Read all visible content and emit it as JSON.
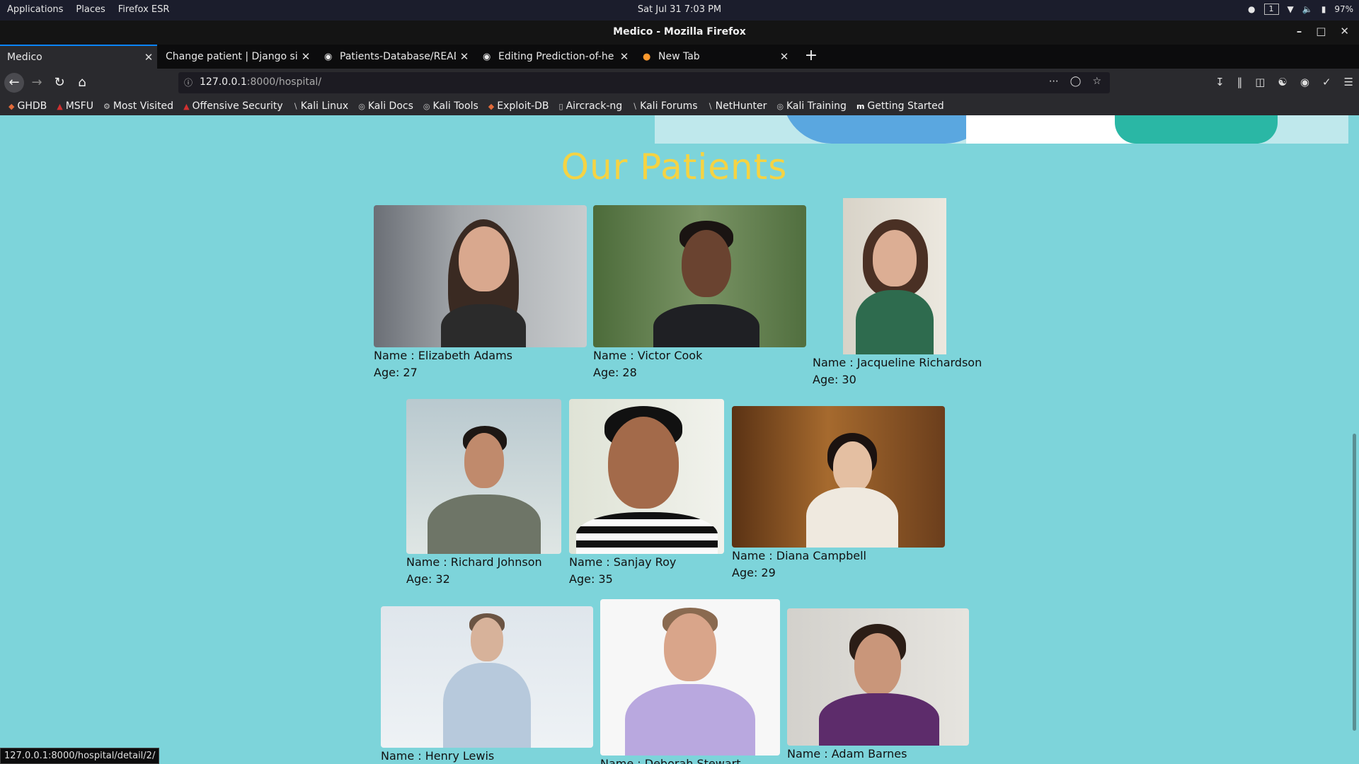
{
  "system": {
    "menus": [
      "Applications",
      "Places",
      "Firefox ESR"
    ],
    "clock": "Sat Jul 31   7:03 PM",
    "workspace": "1",
    "battery": "97%"
  },
  "window": {
    "title": "Medico - Mozilla Firefox"
  },
  "tabs": [
    {
      "title": "Medico",
      "favicon": "none"
    },
    {
      "title": "Change patient | Django site",
      "favicon": "none"
    },
    {
      "title": "Patients-Database/READ",
      "favicon": "github-icon"
    },
    {
      "title": "Editing Prediction-of-he",
      "favicon": "github-icon"
    },
    {
      "title": "New Tab",
      "favicon": "firefox-icon"
    }
  ],
  "address": {
    "host": "127.0.0.1",
    "rest": ":8000/hospital/"
  },
  "bookmarks": [
    "GHDB",
    "MSFU",
    "Most Visited",
    "Offensive Security",
    "Kali Linux",
    "Kali Docs",
    "Kali Tools",
    "Exploit-DB",
    "Aircrack-ng",
    "Kali Forums",
    "NetHunter",
    "Kali Training",
    "Getting Started"
  ],
  "page": {
    "heading": "Our Patients",
    "patients": [
      {
        "name": "Name : Elizabeth Adams",
        "age": "Age: 27"
      },
      {
        "name": "Name : Victor Cook",
        "age": "Age: 28"
      },
      {
        "name": "Name : Jacqueline Richardson",
        "age": "Age: 30"
      },
      {
        "name": "Name : Richard Johnson",
        "age": "Age: 32"
      },
      {
        "name": "Name : Sanjay Roy",
        "age": "Age: 35"
      },
      {
        "name": "Name : Diana Campbell",
        "age": "Age: 29"
      },
      {
        "name": "Name : Henry Lewis",
        "age": ""
      },
      {
        "name": "Name : Deborah Stewart",
        "age": ""
      },
      {
        "name": "Name : Adam Barnes",
        "age": ""
      }
    ]
  },
  "status": {
    "link": "127.0.0.1:8000/hospital/detail/2/"
  },
  "colors": {
    "page_bg": "#7dd4da",
    "heading": "#f5d343",
    "tab_accent": "#0a84ff"
  }
}
